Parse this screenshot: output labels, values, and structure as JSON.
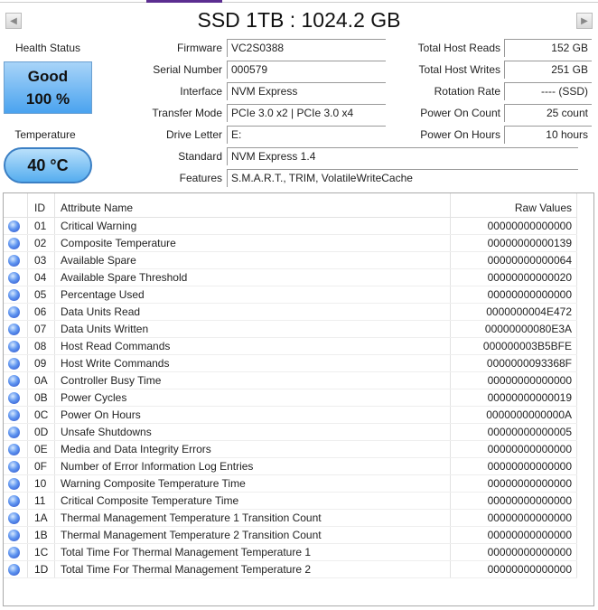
{
  "title": "SSD 1TB : 1024.2 GB",
  "health": {
    "label": "Health Status",
    "status": "Good",
    "percent": "100 %"
  },
  "temperature": {
    "label": "Temperature",
    "value": "40 °C"
  },
  "info": [
    {
      "label": "Firmware",
      "value": "VC2S0388"
    },
    {
      "label": "Serial Number",
      "value": "000579"
    },
    {
      "label": "Interface",
      "value": "NVM Express"
    },
    {
      "label": "Transfer Mode",
      "value": "PCIe 3.0 x2 | PCIe 3.0 x4"
    },
    {
      "label": "Drive Letter",
      "value": "E:"
    },
    {
      "label": "Standard",
      "value": "NVM Express 1.4"
    },
    {
      "label": "Features",
      "value": "S.M.A.R.T., TRIM, VolatileWriteCache"
    }
  ],
  "stats": [
    {
      "label": "Total Host Reads",
      "value": "152 GB"
    },
    {
      "label": "Total Host Writes",
      "value": "251 GB"
    },
    {
      "label": "Rotation Rate",
      "value": "---- (SSD)"
    },
    {
      "label": "Power On Count",
      "value": "25 count"
    },
    {
      "label": "Power On Hours",
      "value": "10 hours"
    }
  ],
  "table": {
    "headers": {
      "id": "ID",
      "name": "Attribute Name",
      "raw": "Raw Values"
    },
    "rows": [
      [
        "01",
        "Critical Warning",
        "00000000000000"
      ],
      [
        "02",
        "Composite Temperature",
        "00000000000139"
      ],
      [
        "03",
        "Available Spare",
        "00000000000064"
      ],
      [
        "04",
        "Available Spare Threshold",
        "00000000000020"
      ],
      [
        "05",
        "Percentage Used",
        "00000000000000"
      ],
      [
        "06",
        "Data Units Read",
        "0000000004E472"
      ],
      [
        "07",
        "Data Units Written",
        "00000000080E3A"
      ],
      [
        "08",
        "Host Read Commands",
        "000000003B5BFE"
      ],
      [
        "09",
        "Host Write Commands",
        "0000000093368F"
      ],
      [
        "0A",
        "Controller Busy Time",
        "00000000000000"
      ],
      [
        "0B",
        "Power Cycles",
        "00000000000019"
      ],
      [
        "0C",
        "Power On Hours",
        "0000000000000A"
      ],
      [
        "0D",
        "Unsafe Shutdowns",
        "00000000000005"
      ],
      [
        "0E",
        "Media and Data Integrity Errors",
        "00000000000000"
      ],
      [
        "0F",
        "Number of Error Information Log Entries",
        "00000000000000"
      ],
      [
        "10",
        "Warning Composite Temperature Time",
        "00000000000000"
      ],
      [
        "11",
        "Critical Composite Temperature Time",
        "00000000000000"
      ],
      [
        "1A",
        "Thermal Management Temperature 1 Transition Count",
        "00000000000000"
      ],
      [
        "1B",
        "Thermal Management Temperature 2 Transition Count",
        "00000000000000"
      ],
      [
        "1C",
        "Total Time For Thermal Management Temperature 1",
        "00000000000000"
      ],
      [
        "1D",
        "Total Time For Thermal Management Temperature 2",
        "00000000000000"
      ]
    ]
  }
}
